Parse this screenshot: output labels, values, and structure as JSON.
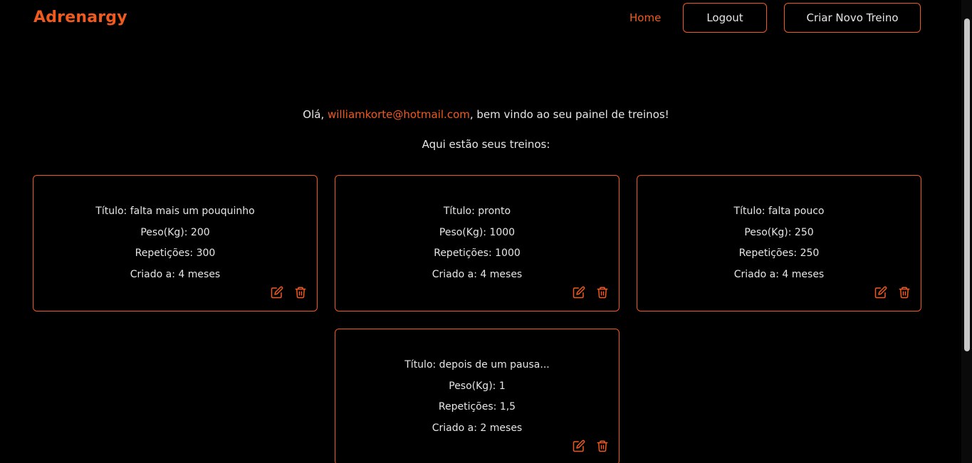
{
  "header": {
    "brand": "Adrenargy",
    "home_label": "Home",
    "logout_label": "Logout",
    "new_workout_label": "Criar Novo Treino"
  },
  "greeting": {
    "prefix": "Olá, ",
    "email": "williamkorte@hotmail.com",
    "suffix": ", bem vindo ao seu painel de treinos!"
  },
  "subtitle": "Aqui estão seus treinos:",
  "workouts": [
    {
      "title": "Título: falta mais um pouquinho",
      "weight": "Peso(Kg): 200",
      "reps": "Repetições: 300",
      "created": "Criado a: 4 meses"
    },
    {
      "title": "Título: pronto",
      "weight": "Peso(Kg): 1000",
      "reps": "Repetições: 1000",
      "created": "Criado a: 4 meses"
    },
    {
      "title": "Título: falta pouco",
      "weight": "Peso(Kg): 250",
      "reps": "Repetições: 250",
      "created": "Criado a: 4 meses"
    },
    {
      "title": "Título: depois de um pausa...",
      "weight": "Peso(Kg): 1",
      "reps": "Repetições: 1,5",
      "created": "Criado a: 2 meses"
    }
  ],
  "icons": {
    "edit": "edit-icon",
    "delete": "trash-icon"
  },
  "colors": {
    "accent": "#f05a1e",
    "background": "#000000",
    "text": "#e6e6e6"
  }
}
